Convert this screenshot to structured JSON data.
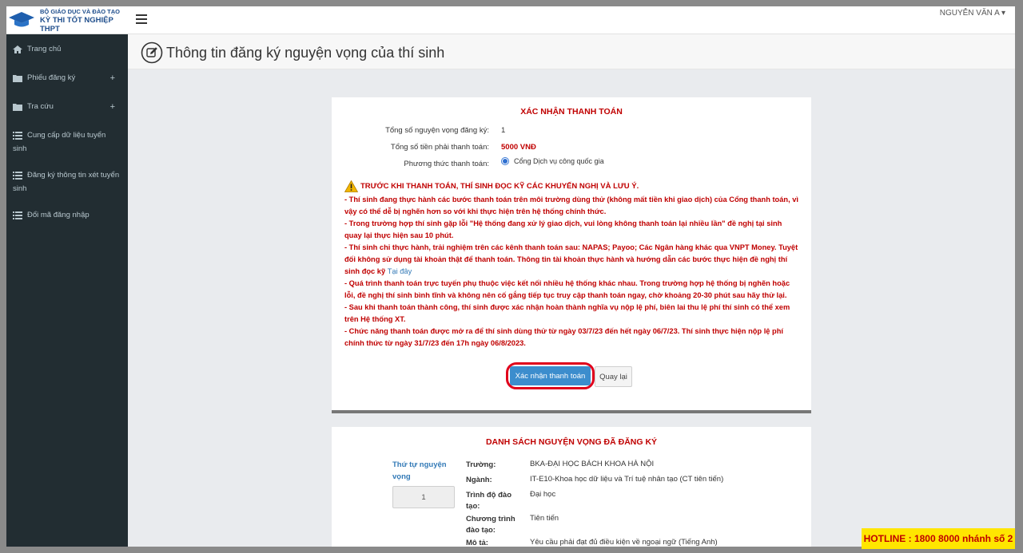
{
  "logo": {
    "line1": "BỘ GIÁO DỤC VÀ ĐÀO TẠO",
    "line2": "KỲ THI TỐT NGHIỆP THPT"
  },
  "sidebar": {
    "items": [
      {
        "label": "Trang chủ",
        "icon": "home-icon",
        "has_plus": false
      },
      {
        "label": "Phiếu đăng ký",
        "icon": "folder-icon",
        "has_plus": true
      },
      {
        "label": "Tra cứu",
        "icon": "folder-icon",
        "has_plus": true
      },
      {
        "label": "Cung cấp dữ liệu tuyển sinh",
        "icon": "list-icon",
        "has_plus": false
      },
      {
        "label": "Đăng ký thông tin xét tuyển sinh",
        "icon": "list-icon",
        "has_plus": false
      },
      {
        "label": "Đổi mã đăng nhập",
        "icon": "list-icon",
        "has_plus": false
      }
    ],
    "plus_symbol": "+"
  },
  "topbar": {
    "user_name": "NGUYỄN VĂN A ▾"
  },
  "page": {
    "title": "Thông tin đăng ký nguyện vọng của thí sinh"
  },
  "payment": {
    "title": "XÁC NHẬN THANH TOÁN",
    "rows": [
      {
        "label": "Tổng số nguyện vọng đăng ký:",
        "value": "1"
      },
      {
        "label": "Tổng số tiền phải thanh toán:",
        "value": "5000 VNĐ"
      },
      {
        "label": "Phương thức thanh toán:",
        "value": "Cổng Dịch vụ công quốc gia"
      }
    ],
    "warning_heading": "TRƯỚC KHI THANH TOÁN, THÍ SINH ĐỌC KỸ CÁC KHUYẾN NGHỊ VÀ LƯU Ý.",
    "notes": [
      "- Thí sinh đang thực hành các bước thanh toán trên môi trường dùng thử (không mất tiền khi giao dịch) của Cổng thanh toán, vì vậy có thể dễ bị nghẽn hơn so với khi thực hiện trên hệ thống chính thức.",
      "- Trong trường hợp thí sinh gặp lỗi \"Hệ thống đang xử lý giao dịch, vui lòng không thanh toán lại nhiều lần\" đề nghị tại sinh quay lại thực hiện sau 10 phút.",
      "- Thí sinh chỉ thực hành, trải nghiệm trên các kênh thanh toán sau: NAPAS; Payoo; Các Ngân hàng khác qua VNPT Money. Tuyệt đối không sử dụng tài khoản thật để thanh toán. Thông tin tài khoản thực hành và hướng dẫn các bước thực hiện đề nghị thí sinh đọc kỹ",
      "- Quá trình thanh toán trực tuyến phụ thuộc việc kết nối nhiều hệ thống khác nhau. Trong trường hợp hệ thống bị nghẽn hoặc lỗi, đề nghị thí sinh bình tĩnh và không nên cố gắng tiếp tục truy cập thanh toán ngay, chờ khoảng 20-30 phút sau hãy thử lại.",
      "- Sau khi thanh toán thành công, thí sinh được xác nhận hoàn thành nghĩa vụ nộp lệ phí, biên lai thu lệ phí thí sinh có thể xem trên Hệ thống XT.",
      "- Chức năng thanh toán được mở ra để thí sinh dùng thử từ ngày 03/7/23 đến hết ngày 06/7/23. Thí sinh thực hiện nộp lệ phí chính thức từ ngày 31/7/23 đến 17h ngày 06/8/2023."
    ],
    "link_text": "Tại đây",
    "confirm_label": "Xác nhận thanh toán",
    "back_label": "Quay lại"
  },
  "wishlist": {
    "title": "DANH SÁCH NGUYỆN VỌNG ĐÃ ĐĂNG KÝ",
    "order_label": "Thứ tự nguyện vọng",
    "order_value": "1",
    "details": [
      {
        "label": "Trường:",
        "value": "BKA-ĐẠI HỌC BÁCH KHOA HÀ NỘI"
      },
      {
        "label": "Ngành:",
        "value": "IT-E10-Khoa học dữ liệu và Trí tuệ nhân tạo (CT tiên tiến)"
      },
      {
        "label": "Trình độ đào tạo:",
        "value": "Đại học"
      },
      {
        "label": "Chương trình đào tạo:",
        "value": "Tiên tiến"
      },
      {
        "label": "Mô tả:",
        "value": "Yêu cầu phải đạt đủ điều kiện về ngoại ngữ (Tiếng Anh)"
      }
    ]
  },
  "hotline": "HOTLINE : 1800 8000 nhánh số 2",
  "colors": {
    "sidebar_bg": "#222d32",
    "accent_red": "#c00000",
    "confirm_button": "#3c8dcd",
    "highlight_ring": "#e0001b",
    "hotline_bg": "#ffe600"
  }
}
